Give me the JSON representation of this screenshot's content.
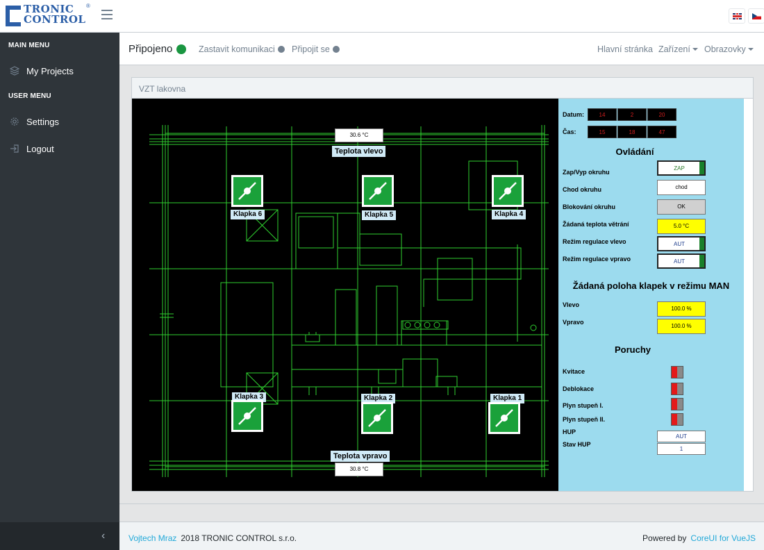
{
  "header": {
    "logo_line1": "TRONIC",
    "logo_line2": "CONTROL",
    "logo_reg": "®",
    "languages": [
      "en",
      "cz"
    ]
  },
  "sidebar": {
    "main_menu_title": "MAIN MENU",
    "user_menu_title": "USER MENU",
    "items": [
      {
        "label": "My Projects",
        "icon": "layers-icon"
      },
      {
        "label": "Settings",
        "icon": "gear-icon"
      },
      {
        "label": "Logout",
        "icon": "logout-icon"
      }
    ]
  },
  "topbar": {
    "status": "Připojeno",
    "status_color": "#1a9641",
    "stop_link": "Zastavit komunikaci",
    "connect_link": "Připojit se",
    "nav": [
      "Hlavní stránka",
      "Zařízení",
      "Obrazovky"
    ]
  },
  "card": {
    "title": "VZT lakovna"
  },
  "plan": {
    "temp_left_value": "30.6 °C",
    "temp_left_label": "Teplota vlevo",
    "temp_right_value": "30.8 °C",
    "temp_right_label": "Teplota vpravo",
    "valves": [
      "Klapka 1",
      "Klapka 2",
      "Klapka 3",
      "Klapka 4",
      "Klapka 5",
      "Klapka 6"
    ],
    "line_color": "#33dd33",
    "valve_color": "#1aa13a"
  },
  "panel": {
    "date_label": "Datum:",
    "date_values": [
      "14",
      "2",
      "20"
    ],
    "time_label": "Čas:",
    "time_values": [
      "15",
      "18",
      "47"
    ],
    "control_title": "Ovládání",
    "controls": [
      {
        "label": "Zap/Vyp okruhu",
        "value": "ZAP"
      },
      {
        "label": "Chod okruhu",
        "value": "chod"
      },
      {
        "label": "Blokování okruhu",
        "value": "OK"
      },
      {
        "label": "Žádaná teplota větrání",
        "value": "5.0 °C"
      },
      {
        "label": "Režim regulace vlevo",
        "value": "AUT"
      },
      {
        "label": "Režim regulace vpravo",
        "value": "AUT"
      }
    ],
    "man_title": "Žádaná poloha klapek v režimu MAN",
    "man": [
      {
        "label": "Vlevo",
        "value": "100.0 %"
      },
      {
        "label": "Vpravo",
        "value": "100.0 %"
      }
    ],
    "faults_title": "Poruchy",
    "faults": [
      "Kvitace",
      "Deblokace",
      "Plyn stupeň I.",
      "Plyn stupeň II."
    ],
    "hup_label": "HUP",
    "hup_value": "AUT",
    "stav_hup_label": "Stav HUP",
    "stav_hup_value": "1"
  },
  "footer": {
    "author": "Vojtech Mraz",
    "copyright": "2018 TRONIC CONTROL s.r.o.",
    "powered_by": "Powered by",
    "framework": "CoreUI for VueJS"
  }
}
